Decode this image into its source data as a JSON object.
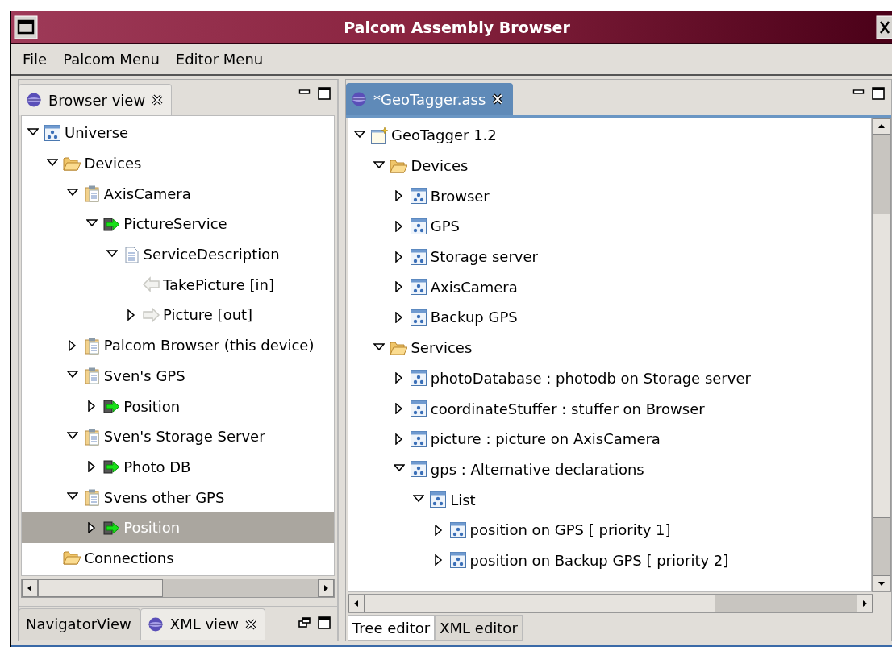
{
  "window": {
    "title": "Palcom Assembly Browser"
  },
  "menu": [
    {
      "label": "File"
    },
    {
      "label": "Palcom Menu"
    },
    {
      "label": "Editor Menu"
    }
  ],
  "left_panel": {
    "tabs": [
      {
        "label": "Browser view",
        "selected": true,
        "closable": true,
        "kind": "view"
      }
    ],
    "tree": [
      {
        "label": "Universe",
        "kind": "component",
        "expandable": true,
        "expanded": true,
        "selected": false,
        "children": [
          {
            "label": "Devices",
            "kind": "folder",
            "expandable": true,
            "expanded": true,
            "selected": false,
            "children": [
              {
                "label": "AxisCamera",
                "kind": "device",
                "expandable": true,
                "expanded": true,
                "selected": false,
                "children": [
                  {
                    "label": "PictureService",
                    "kind": "service",
                    "expandable": true,
                    "expanded": true,
                    "selected": false,
                    "children": [
                      {
                        "label": "ServiceDescription",
                        "kind": "document",
                        "expandable": true,
                        "expanded": true,
                        "selected": false,
                        "children": [
                          {
                            "label": "TakePicture [in]",
                            "kind": "in",
                            "expandable": false,
                            "selected": false
                          },
                          {
                            "label": "Picture [out]",
                            "kind": "out",
                            "expandable": true,
                            "expanded": false,
                            "selected": false
                          }
                        ]
                      }
                    ]
                  }
                ]
              },
              {
                "label": "Palcom Browser (this device)",
                "kind": "device",
                "expandable": true,
                "expanded": false,
                "selected": false
              },
              {
                "label": "Sven's GPS",
                "kind": "device",
                "expandable": true,
                "expanded": true,
                "selected": false,
                "children": [
                  {
                    "label": "Position",
                    "kind": "service",
                    "expandable": true,
                    "expanded": false,
                    "selected": false
                  }
                ]
              },
              {
                "label": "Sven's Storage Server",
                "kind": "device",
                "expandable": true,
                "expanded": true,
                "selected": false,
                "children": [
                  {
                    "label": "Photo DB",
                    "kind": "service",
                    "expandable": true,
                    "expanded": false,
                    "selected": false
                  }
                ]
              },
              {
                "label": "Svens other GPS",
                "kind": "device",
                "expandable": true,
                "expanded": true,
                "selected": false,
                "children": [
                  {
                    "label": "Position",
                    "kind": "service",
                    "expandable": true,
                    "expanded": false,
                    "selected": true
                  }
                ]
              }
            ]
          },
          {
            "label": "Connections",
            "kind": "folder",
            "expandable": false,
            "selected": false
          }
        ]
      }
    ],
    "bottom_tabs": [
      {
        "label": "NavigatorView",
        "selected": false,
        "closable": false,
        "kind": "plain"
      },
      {
        "label": "XML view",
        "selected": true,
        "closable": true,
        "kind": "view"
      }
    ]
  },
  "editor": {
    "tabs": [
      {
        "label": "*GeoTagger.ass",
        "selected": true,
        "closable": true,
        "kind": "view"
      }
    ],
    "tree": [
      {
        "label": "GeoTagger 1.2",
        "kind": "assembly",
        "expandable": true,
        "expanded": true,
        "selected": false,
        "children": [
          {
            "label": "Devices",
            "kind": "folder",
            "expandable": true,
            "expanded": true,
            "selected": false,
            "children": [
              {
                "label": "Browser",
                "kind": "component",
                "expandable": true,
                "expanded": false,
                "selected": false
              },
              {
                "label": "GPS",
                "kind": "component",
                "expandable": true,
                "expanded": false,
                "selected": false
              },
              {
                "label": "Storage server",
                "kind": "component",
                "expandable": true,
                "expanded": false,
                "selected": false
              },
              {
                "label": "AxisCamera",
                "kind": "component",
                "expandable": true,
                "expanded": false,
                "selected": false
              },
              {
                "label": "Backup GPS",
                "kind": "component",
                "expandable": true,
                "expanded": false,
                "selected": false
              }
            ]
          },
          {
            "label": "Services",
            "kind": "folder",
            "expandable": true,
            "expanded": true,
            "selected": false,
            "children": [
              {
                "label": "photoDatabase : photodb on Storage server",
                "kind": "component",
                "expandable": true,
                "expanded": false,
                "selected": false
              },
              {
                "label": "coordinateStuffer : stuffer on Browser",
                "kind": "component",
                "expandable": true,
                "expanded": false,
                "selected": false
              },
              {
                "label": "picture : picture on AxisCamera",
                "kind": "component",
                "expandable": true,
                "expanded": false,
                "selected": false
              },
              {
                "label": "gps : Alternative declarations",
                "kind": "component",
                "expandable": true,
                "expanded": true,
                "selected": false,
                "children": [
                  {
                    "label": "List",
                    "kind": "component",
                    "expandable": true,
                    "expanded": true,
                    "selected": false,
                    "children": [
                      {
                        "label": "position on GPS [ priority 1]",
                        "kind": "component",
                        "expandable": true,
                        "expanded": false,
                        "selected": false
                      },
                      {
                        "label": "position on Backup GPS [ priority 2]",
                        "kind": "component",
                        "expandable": true,
                        "expanded": false,
                        "selected": false
                      }
                    ]
                  }
                ]
              }
            ]
          }
        ]
      }
    ],
    "bottom_tabs": [
      {
        "label": "Tree editor",
        "selected": true
      },
      {
        "label": "XML editor",
        "selected": false
      }
    ]
  }
}
